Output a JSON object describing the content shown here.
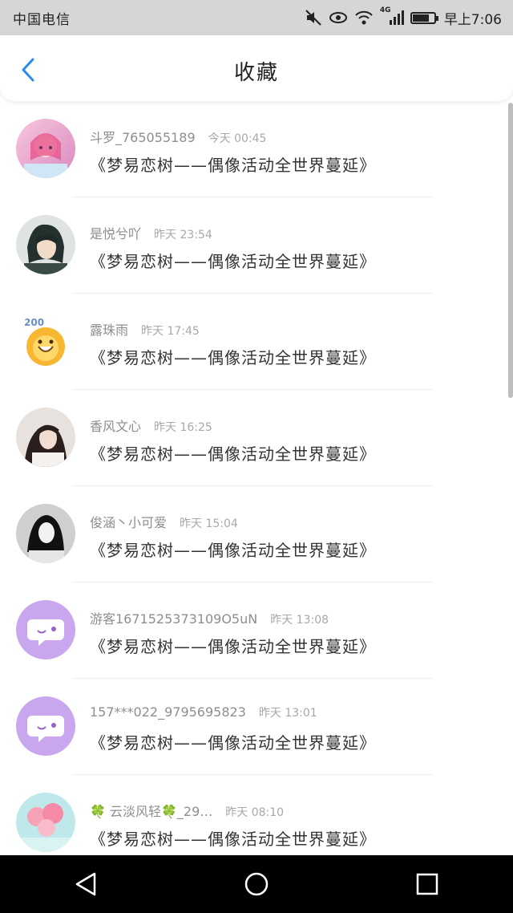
{
  "status_bar": {
    "carrier": "中国电信",
    "time": "早上7:06",
    "network": "4G",
    "icons": [
      "mute-icon",
      "eye-icon",
      "wifi-icon",
      "signal-icon",
      "battery-icon"
    ],
    "battery_level": 0.85
  },
  "header": {
    "title": "收藏",
    "back_icon": "chevron-left-icon",
    "accent": "#2a8cf0"
  },
  "items": [
    {
      "name": "斗罗_765055189",
      "time": "今天 00:45",
      "message": "《梦易恋树——偶像活动全世界蔓延》",
      "avatar": "anime-girl-pink"
    },
    {
      "name": "是悦兮吖",
      "time": "昨天 23:54",
      "message": "《梦易恋树——偶像活动全世界蔓延》",
      "avatar": "anime-boy-dark"
    },
    {
      "name": "露珠雨",
      "time": "昨天 17:45",
      "message": "《梦易恋树——偶像活动全世界蔓延》",
      "avatar": "cartoon-yellow"
    },
    {
      "name": "香风文心",
      "time": "昨天 16:25",
      "message": "《梦易恋树——偶像活动全世界蔓延》",
      "avatar": "photo-girl"
    },
    {
      "name": "俊涵丶小可爱",
      "time": "昨天 15:04",
      "message": "《梦易恋树——偶像活动全世界蔓延》",
      "avatar": "photo-bw"
    },
    {
      "name": "游客1671525373109O5uN",
      "time": "昨天 13:08",
      "message": "《梦易恋树——偶像活动全世界蔓延》",
      "avatar": "default-chat-purple"
    },
    {
      "name": "157***022_9795695823",
      "time": "昨天 13:01",
      "message": "《梦易恋树——偶像活动全世界蔓延》",
      "avatar": "default-chat-purple"
    },
    {
      "name": "🍀 云淡风轻🍀_29…",
      "time": "昨天 08:10",
      "message": "《梦易恋树——偶像活动全世界蔓延》",
      "avatar": "balloons-pink"
    }
  ],
  "nav": {
    "back": "triangle-back-icon",
    "home": "circle-home-icon",
    "recents": "square-recents-icon"
  }
}
